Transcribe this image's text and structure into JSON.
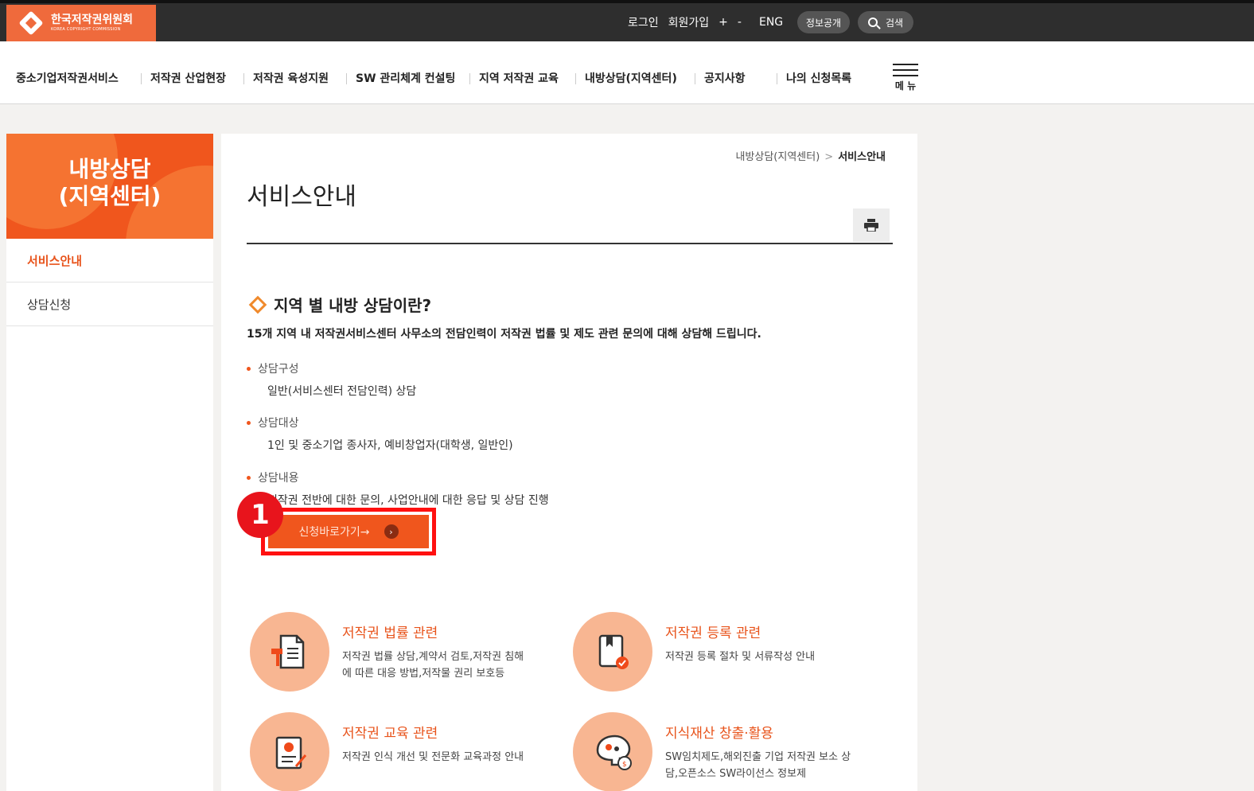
{
  "header": {
    "logo_title": "한국저작권위원회",
    "logo_sub": "KOREA COPYRIGHT COMMISSION",
    "login": "로그인",
    "signup": "회원가입",
    "zoom_in": "+",
    "zoom_out": "-",
    "lang": "ENG",
    "info": "정보공개",
    "search": "검색"
  },
  "nav": {
    "items": [
      "중소기업저작권서비스",
      "저작권 산업현장",
      "저작권 육성지원",
      "SW 관리체계 컨설팅",
      "지역 저작권 교육",
      "내방상담(지역센터)",
      "공지사항",
      "나의 신청목록"
    ],
    "menu_label": "메 뉴"
  },
  "sidebar": {
    "title_line1": "내방상담",
    "title_line2": "(지역센터)",
    "items": [
      "서비스안내",
      "상담신청"
    ]
  },
  "main": {
    "breadcrumb_parent": "내방상담(지역센터)",
    "breadcrumb_sep": ">",
    "breadcrumb_current": "서비스안내",
    "title": "서비스안내",
    "section_title": "지역 별 내방 상담이란?",
    "lead": "15개 지역 내 저작권서비스센터 사무소의 전담인력이 저작권 법률 및 제도 관련 문의에 대해 상담해 드립니다.",
    "blocks": [
      {
        "key": "상담구성",
        "value": "일반(서비스센터 전담인력) 상담"
      },
      {
        "key": "상담대상",
        "value": "1인 및 중소기업 종사자, 예비창업자(대학생, 일반인)"
      },
      {
        "key": "상담내용",
        "value": "저작권 전반에 대한 문의, 사업안내에 대한 응답 및 상담 진행"
      }
    ],
    "apply_label": "신청바로가기→",
    "badge": "1",
    "cards": [
      {
        "title": "저작권 법률 관련",
        "desc": "저작권 법률 상담,계약서 검토,저작권 침해에 따른 대응 방법,저작물 권리 보호등",
        "icon": "legal-document-icon"
      },
      {
        "title": "저작권 등록 관련",
        "desc": "저작권 등록 절차 및 서류작성 안내",
        "icon": "registration-book-icon"
      },
      {
        "title": "저작권 교육 관련",
        "desc": "저작권 인식 개선 및 전문화 교육과정 안내",
        "icon": "education-certificate-icon"
      },
      {
        "title": "지식재산 창출·활용",
        "desc": "SW임치제도,해외진출 기업 저작권 보소 상담,오픈소스 SW라이선스 정보제",
        "icon": "ip-brain-icon"
      }
    ]
  },
  "colors": {
    "accent": "#f0561d",
    "highlight": "#ff1010",
    "topbar": "#2e2e2e"
  }
}
